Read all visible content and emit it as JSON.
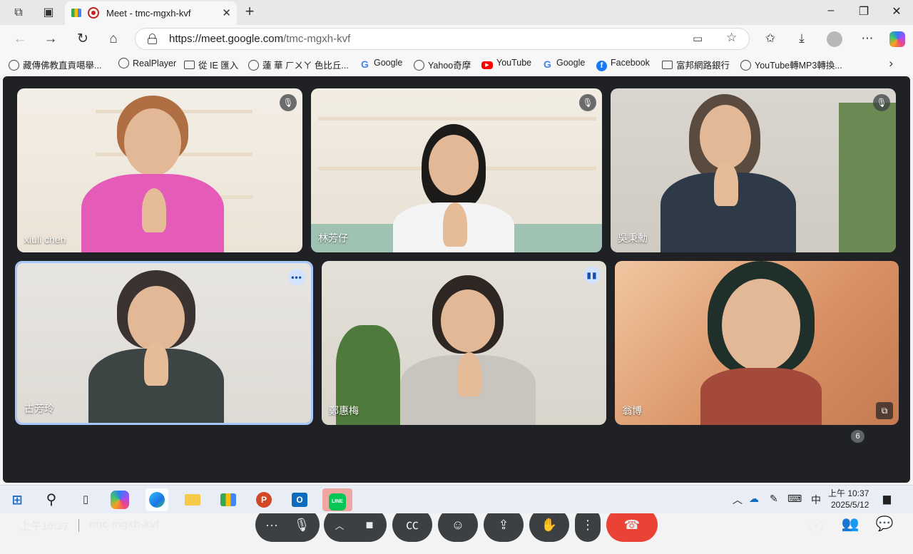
{
  "browser": {
    "tab_title": "Meet - tmc-mgxh-kvf",
    "url_host": "https://meet.google.com",
    "url_path": "/tmc-mgxh-kvf"
  },
  "bookmarks": [
    {
      "label": "藏傳佛教直貢噶舉...",
      "icon": "globe-icon"
    },
    {
      "label": "RealPlayer",
      "icon": "globe-icon"
    },
    {
      "label": "從 IE 匯入",
      "icon": "folder-icon"
    },
    {
      "label": "蓮 華 ㄏㄨㄚ 色比丘...",
      "icon": "globe-icon"
    },
    {
      "label": "Google",
      "icon": "google-icon"
    },
    {
      "label": "Yahoo奇摩",
      "icon": "globe-icon"
    },
    {
      "label": "YouTube",
      "icon": "youtube-icon"
    },
    {
      "label": "Google",
      "icon": "google-icon"
    },
    {
      "label": "Facebook",
      "icon": "facebook-icon"
    },
    {
      "label": "富邦網路銀行",
      "icon": "folder-icon"
    },
    {
      "label": "YouTube轉MP3轉換...",
      "icon": "globe-icon"
    }
  ],
  "participants": [
    {
      "name": "xiuli chen",
      "status": "muted"
    },
    {
      "name": "林芳仔",
      "status": "muted"
    },
    {
      "name": "吳秉勳",
      "status": "muted"
    },
    {
      "name": "古芳玲",
      "status": "more-options"
    },
    {
      "name": "鄭惠梅",
      "status": "speaking"
    },
    {
      "name": "翁博",
      "status": "pin"
    }
  ],
  "meeting": {
    "time": "上午10:37",
    "code": "tmc-mgxh-kvf",
    "participant_count": "6"
  },
  "taskbar": {
    "ime": "中",
    "time": "上午 10:37",
    "date": "2025/5/12"
  },
  "colors": {
    "meet_bg": "#202124",
    "control_bg": "#3c4043",
    "end_call": "#ea4335",
    "active_border": "#a8c7fa"
  }
}
